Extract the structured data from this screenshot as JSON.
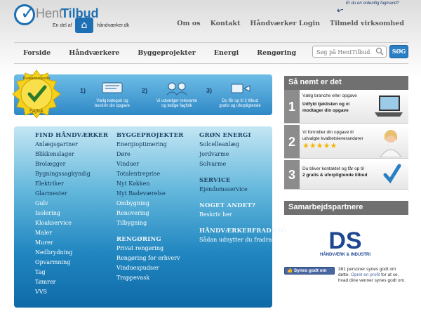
{
  "logo": {
    "hent": "Hent",
    "tilbud": "Tilbud",
    "part_of": "En del af",
    "partner_site": "håndværker.dk"
  },
  "note": "Er du en ordentlig fagmand?",
  "topnav": [
    "Om os",
    "Kontakt",
    "Håndværker Login",
    "Tilmeld virksomhed"
  ],
  "mainnav": [
    "Forside",
    "Håndværkere",
    "Byggeprojekter",
    "Energi",
    "Rengøring"
  ],
  "search": {
    "placeholder": "Søg på HentTilbud",
    "button": "SØG"
  },
  "seal": {
    "top": "Kvalitetssikrede",
    "bottom": "Fagfolk"
  },
  "steps": [
    {
      "num": "1)",
      "text": [
        "Vælg kategori og",
        "beskriv din opgave"
      ]
    },
    {
      "num": "2)",
      "text": [
        "Vi udvælger relevante",
        "og ledige fagfolk"
      ]
    },
    {
      "num": "3)",
      "text": [
        "Du får op til 2 tilbud",
        "gratis og uforpligtende"
      ]
    }
  ],
  "categories": {
    "col1": {
      "heading": "FIND HÅNDVÆRKER",
      "links": [
        "Anlægsgartner",
        "Blikkenslager",
        "Brolægger",
        "Bygningssagkyndig",
        "Elektriker",
        "Glarmester",
        "Gulv",
        "Isolering",
        "Kloakservice",
        "Maler",
        "Murer",
        "Nedbrydning",
        "Opvarmning",
        "Tag",
        "Tømrer",
        "VVS"
      ]
    },
    "col2": {
      "heading": "BYGGEPROJEKTER",
      "links": [
        "Energioptimering",
        "Døre",
        "Vinduer",
        "Totalentreprise",
        "Nyt Køkken",
        "Nyt Badeværelse",
        "Ombygning",
        "Renovering",
        "Tilbygning"
      ],
      "heading2": "RENGØRING",
      "links2": [
        "Privat rengøring",
        "Rengøring for erhverv",
        "Vinduespudser",
        "Trappevask"
      ]
    },
    "col3": {
      "heading": "GRØN ENERGI",
      "links": [
        "Solcelleanlæg",
        "Jordvarme",
        "Solvarme"
      ],
      "heading2": "SERVICE",
      "links2": [
        "Ejendomsservice"
      ],
      "heading3": "NOGET ANDET?",
      "links3": [
        "Beskriv her"
      ],
      "heading4": "HÅNDVÆRKERFRADRAG",
      "links4": [
        "Sådan udnytter du fradrag"
      ]
    }
  },
  "right": {
    "title": "Så nemt er det",
    "steps": [
      {
        "num": "1",
        "line1": "Vælg branche eller opgave",
        "line2": "Udfyld tjeklisten og vi",
        "line3": "modtager din opgave"
      },
      {
        "num": "2",
        "line1": "Vi formidler din opgave til",
        "line2": "udvalgte kvalitetsleverandører",
        "stars": "★★★★★"
      },
      {
        "num": "3",
        "line1": "Du bliver kontaktet og får op til",
        "line2": "2 gratis & uforpligtende tilbud"
      }
    ],
    "partners_title": "Samarbejdspartnere",
    "partner": {
      "mark": "DS",
      "name": "HÅNDVÆRK & INDUSTRI"
    },
    "facebook": {
      "button": "Synes godt om",
      "text1": "381 personer synes godt om dette.",
      "link": "Opret en profil",
      "text2": "for at se, hvad dine venner synes godt om."
    }
  }
}
